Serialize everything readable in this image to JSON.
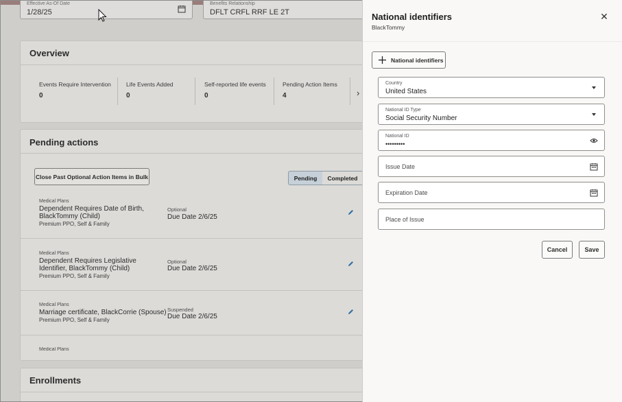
{
  "background": {
    "effective_date": {
      "label": "Effective As-Of Date",
      "value": "1/28/25"
    },
    "relationship": {
      "label": "Benefits Relationship",
      "value": "DFLT CRFL RRF LE 2T"
    },
    "overview": {
      "title": "Overview",
      "metrics": [
        {
          "label": "Events Require Intervention",
          "value": "0"
        },
        {
          "label": "Life Events Added",
          "value": "0"
        },
        {
          "label": "Self-reported life events",
          "value": "0"
        },
        {
          "label": "Pending Action Items",
          "value": "4"
        }
      ],
      "next_symbol": "›"
    },
    "pending_actions": {
      "title": "Pending actions",
      "bulk_button": "Close Past Optional Action Items in Bulk",
      "segments": [
        "Pending",
        "Completed"
      ],
      "items": [
        {
          "category": "Medical Plans",
          "title": "Dependent Requires Date of Birth, BlackTommy (Child)",
          "subtitle": "Premium PPO, Self & Family",
          "status": "Optional",
          "due": "Due Date 2/6/25"
        },
        {
          "category": "Medical Plans",
          "title": "Dependent Requires Legislative Identifier, BlackTommy (Child)",
          "subtitle": "Premium PPO, Self & Family",
          "status": "Optional",
          "due": "Due Date 2/6/25"
        },
        {
          "category": "Medical Plans",
          "title": "Marriage certificate, BlackCorrie (Spouse)",
          "subtitle": "Premium PPO, Self & Family",
          "status": "Suspended",
          "due": "Due Date 2/6/25"
        },
        {
          "category": "Medical Plans"
        }
      ]
    },
    "enrollments": {
      "title": "Enrollments"
    }
  },
  "drawer": {
    "title": "National identifiers",
    "subtitle": "BlackTommy",
    "close_symbol": "✕",
    "add_button": "National identifiers",
    "fields": {
      "country": {
        "label": "Country",
        "value": "United States"
      },
      "id_type": {
        "label": "National ID Type",
        "value": "Social Security Number"
      },
      "national_id": {
        "label": "National ID",
        "value": "•••••••••"
      },
      "issue_date": {
        "placeholder": "Issue Date"
      },
      "expiration_date": {
        "placeholder": "Expiration Date"
      },
      "place_of_issue": {
        "placeholder": "Place of Issue"
      }
    },
    "cancel": "Cancel",
    "save": "Save"
  },
  "icons": [
    "calendar-icon",
    "chevron-down-icon",
    "eye-icon",
    "plus-icon",
    "close-icon",
    "pencil-icon",
    "chevron-right-icon",
    "mouse-cursor-icon"
  ],
  "colors": {
    "accent": "#2f6ea3",
    "overlay": "#cfcecb",
    "drawer": "#f9f8f6"
  }
}
